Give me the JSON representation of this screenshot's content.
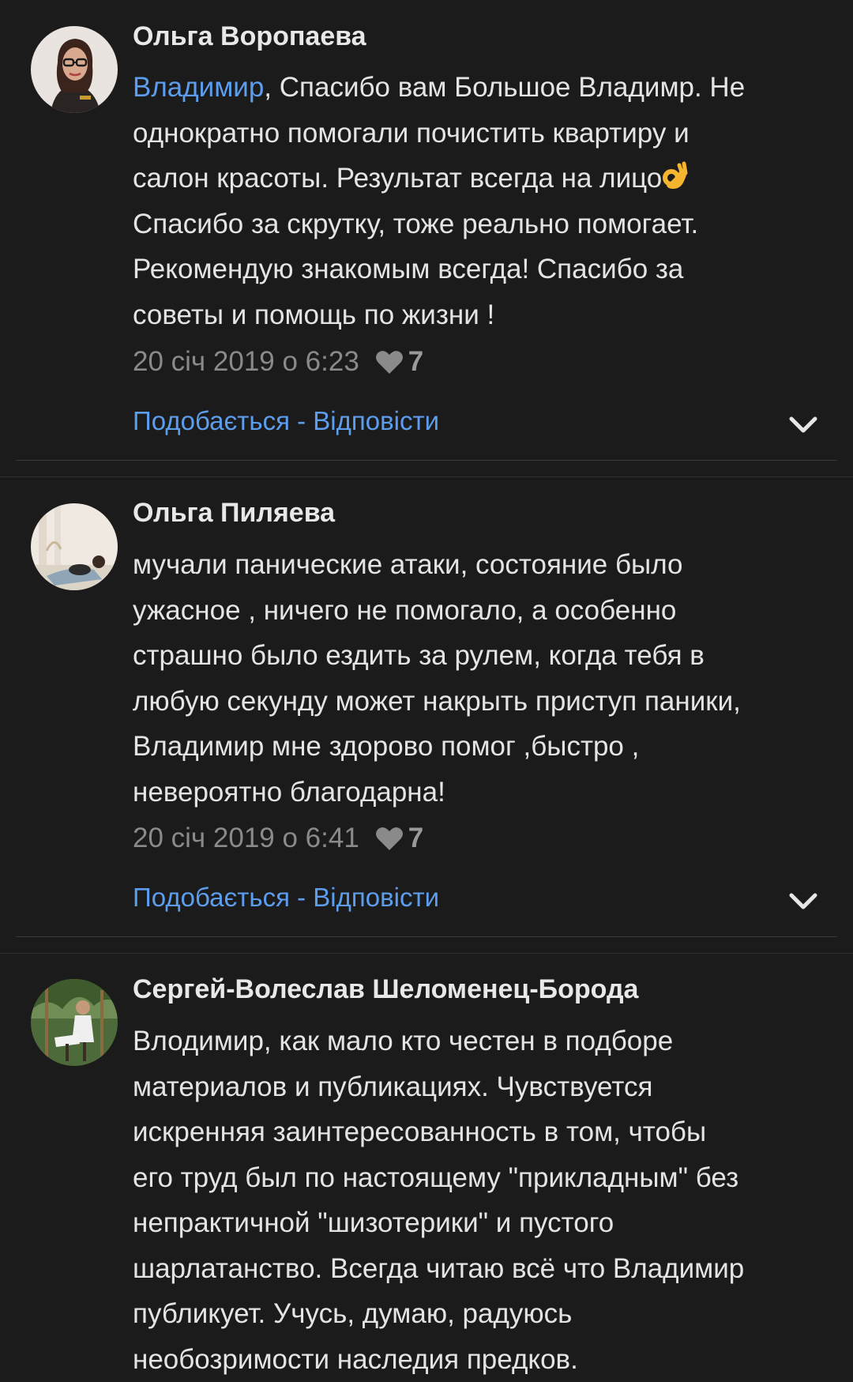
{
  "comments": [
    {
      "author": "Ольга Воропаева",
      "mention": "Владимир",
      "lines": [
        ", Спасибо вам Большое Владимр. Не",
        "однократно помогали почистить квартиру и",
        "салон красоты. Результат всегда на лицо",
        "Спасибо за скрутку, тоже реально помогает.",
        "Рекомендую знакомым всегда! Спасибо за",
        "советы и помощь по жизни !"
      ],
      "emoji": "ok-hand-emoji",
      "timestamp": "20 січ 2019 о 6:23",
      "likes": "7",
      "like_label": "Подобається",
      "separator": " - ",
      "reply_label": "Відповісти"
    },
    {
      "author": "Ольга Пиляева",
      "lines": [
        "мучали панические атаки, состояние было",
        "ужасное , ничего не помогало, а особенно",
        "страшно было ездить за рулем, когда тебя в",
        "любую секунду может накрыть приступ паники,",
        "Владимир мне здорово помог ,быстро ,",
        "невероятно благодарна!"
      ],
      "timestamp": "20 січ 2019 о 6:41",
      "likes": "7",
      "like_label": "Подобається",
      "separator": " - ",
      "reply_label": "Відповісти"
    },
    {
      "author": "Сергей-Волеслав Шеломенец-Борода",
      "lines": [
        "Влодимир, как мало кто честен в подборе",
        "материалов и публикациях. Чувствуется",
        "искренняя заинтересованность в том, чтобы",
        "его труд был по настоящему \"прикладным\" без",
        "непрактичной \"шизотерики\" и пустого",
        "шарлатанство. Всегда читаю всё что Владимир",
        "публикует. Учусь, думаю, радуюсь",
        "необозримости наследия предков."
      ]
    }
  ],
  "icons": {
    "heart": "heart-icon",
    "expand": "chevron-down-icon"
  },
  "colors": {
    "background": "#1b1b1c",
    "link": "#5c9ded",
    "text": "#e4e4e4",
    "muted": "#8a8a8a"
  }
}
